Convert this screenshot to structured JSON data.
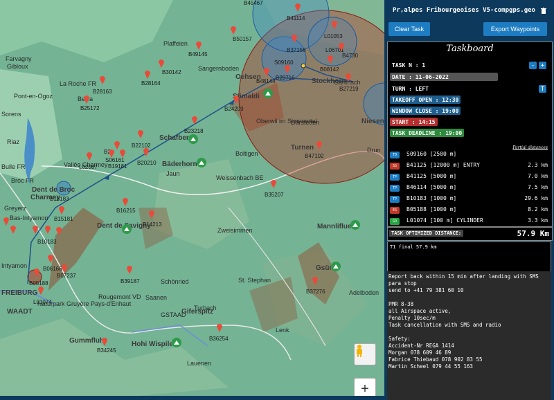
{
  "header": {
    "file_name": "Pr,alpes Fribourgeoises V5-compgps.geo",
    "delete_icon": "trash-icon"
  },
  "buttons": {
    "clear_task": "Clear Task",
    "export_waypoints": "Export Waypoints"
  },
  "taskboard": {
    "title": "Taskboard",
    "task_n": "TASK N : 1",
    "date": "DATE : 11-06-2022",
    "turn": "TURN : LEFT",
    "takeoff_open": "TAKEOFF OPEN : 12:30",
    "window_close": "WINDOW CLOSE : 19:00",
    "start": "START : 14:15",
    "task_deadline": "TASK DEADLINE : 19:00",
    "minus": "-",
    "plus": "+",
    "t_button": "T",
    "partial_distances": "Partial distances",
    "turnpoints": [
      {
        "type": "TO",
        "color": "#1e7cc2",
        "name": "S09160 [2500 m]",
        "dist": ""
      },
      {
        "type": "SS",
        "color": "#c0392b",
        "name": "B41125 [12000 m] ENTRY",
        "dist": "2.3 km"
      },
      {
        "type": "TP",
        "color": "#1e7cc2",
        "name": "B41125 [5000 m]",
        "dist": "7.0 km"
      },
      {
        "type": "TP",
        "color": "#1e7cc2",
        "name": "B46114 [5000 m]",
        "dist": "7.5 km"
      },
      {
        "type": "TP",
        "color": "#1e7cc2",
        "name": "B10183 [1000 m]",
        "dist": "29.6 km"
      },
      {
        "type": "ES",
        "color": "#c0392b",
        "name": "B05188 [1000 m]",
        "dist": "8.2 km"
      },
      {
        "type": "GO",
        "color": "#27a344",
        "name": "L01074 [100 m] CYLINDER",
        "dist": "3.3 km"
      }
    ],
    "optimized_label": "TASK OPTIMIZED DISTANCE:",
    "optimized_value": "57.9 Km",
    "notes": "T1 final 57.9 km"
  },
  "info_lines": [
    "Report back within 15 min after landing with SMS",
    "para stop",
    "send to +41 79 381 60 10",
    "",
    "PMR 8-38",
    "all Airspace active,",
    "Penalty 10sec/m",
    "Task cancellation with SMS and radio",
    "",
    "Safety:",
    "Accident-Nr REGA 1414",
    "Morgan 078 609 46 89",
    "Fabrice Thiebaud 078 902 83 55",
    "Martin Scheel 079 44 55 163"
  ],
  "map": {
    "zoom_in": "+",
    "pegman_icon": "pegman-icon",
    "waypoints": [
      "B45467",
      "B41114",
      "L01053",
      "B50157",
      "B49145",
      "S09160",
      "L06701",
      "B37156",
      "B4730",
      "B30142",
      "B08142",
      "B28164",
      "B48144",
      "B29716",
      "B27219",
      "B28163",
      "B25172",
      "B24209",
      "B23218",
      "B22102",
      "B21",
      "S06161",
      "B19181",
      "B20210",
      "L02087",
      "B47102",
      "B18183",
      "B35207",
      "B16215",
      "B14213",
      "B15181",
      "B10183",
      "B06166",
      "B07237",
      "B05188",
      "L01074",
      "B39187",
      "B37276",
      "B36254",
      "B34245"
    ],
    "places": [
      "Farvagny",
      "Gibloux",
      "La Roche FR",
      "Pont-en-Ogoz",
      "Berra",
      "Sorens",
      "Riaz",
      "Bulle FR",
      "Broc FR",
      "Vallée Charmey",
      "Dent de Broc",
      "Charmey",
      "Greyerz",
      "Bas-Intyamon",
      "Dent de Savigny",
      "Intyamon",
      "FREIBURG",
      "WAADT",
      "Naturpark Gruyère Pays-d'Enhaut",
      "Gummfluh",
      "Hohi Wispile",
      "Giferspitz",
      "Lauenen",
      "Turbach",
      "Saanen",
      "GSTAAD",
      "Schönried",
      "Rougemont VD",
      "St. Stephan",
      "Lenk",
      "Zweisimmen",
      "Mannlifluе",
      "Gsür",
      "Adelboden",
      "Boltigen",
      "Jaun",
      "Bäderhorn",
      "Schafberg",
      "Weissenbach BE",
      "Oberwil im Simmental",
      "Därstetten",
      "Turnen",
      "Stockhorn",
      "Gantrisch",
      "Oehsen",
      "Plaffeien",
      "Sangernboden",
      "Stimaldi",
      "Niesen",
      "Drun"
    ]
  }
}
